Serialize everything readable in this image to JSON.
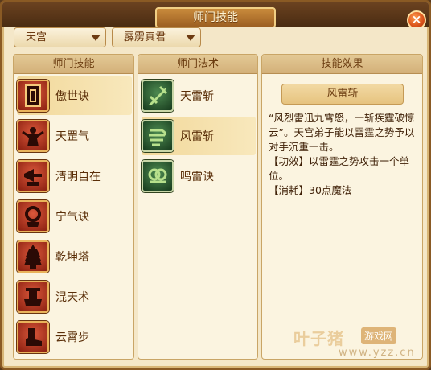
{
  "window": {
    "title": "师门技能",
    "close_label": "×"
  },
  "filters": {
    "sect": "天宫",
    "master": "霹雳真君"
  },
  "skills_panel": {
    "header": "师门技能",
    "items": [
      {
        "label": "傲世诀",
        "icon": "scroll-icon",
        "selected": true
      },
      {
        "label": "天罡气",
        "icon": "warrior-icon",
        "selected": false
      },
      {
        "label": "清明自在",
        "icon": "horn-icon",
        "selected": false
      },
      {
        "label": "宁气诀",
        "icon": "ring-icon",
        "selected": false
      },
      {
        "label": "乾坤塔",
        "icon": "pagoda-icon",
        "selected": false
      },
      {
        "label": "混天术",
        "icon": "altar-icon",
        "selected": false
      },
      {
        "label": "云霄步",
        "icon": "boot-icon",
        "selected": false
      }
    ]
  },
  "arts_panel": {
    "header": "师门法术",
    "items": [
      {
        "label": "天雷斩",
        "icon": "sword-icon",
        "selected": false
      },
      {
        "label": "风雷斩",
        "icon": "wind-icon",
        "selected": true
      },
      {
        "label": "鸣雷诀",
        "icon": "cloud-icon",
        "selected": false
      }
    ]
  },
  "effect_panel": {
    "header": "技能效果",
    "name": "风雷斩",
    "lines": [
      "“风烈雷迅九霄怒，一斩疾霆破惊云”。天宫弟子能以雷霆之势予以对手沉重一击。",
      "【功效】以雷霆之势攻击一个单位。",
      "【消耗】30点魔法"
    ]
  },
  "watermark": {
    "main": "叶子猪",
    "badge": "游戏网",
    "url": "www.yzz.cn"
  },
  "colors": {
    "accent": "#8a5a24",
    "selected": "#f2d89a",
    "text": "#5a2e08"
  }
}
